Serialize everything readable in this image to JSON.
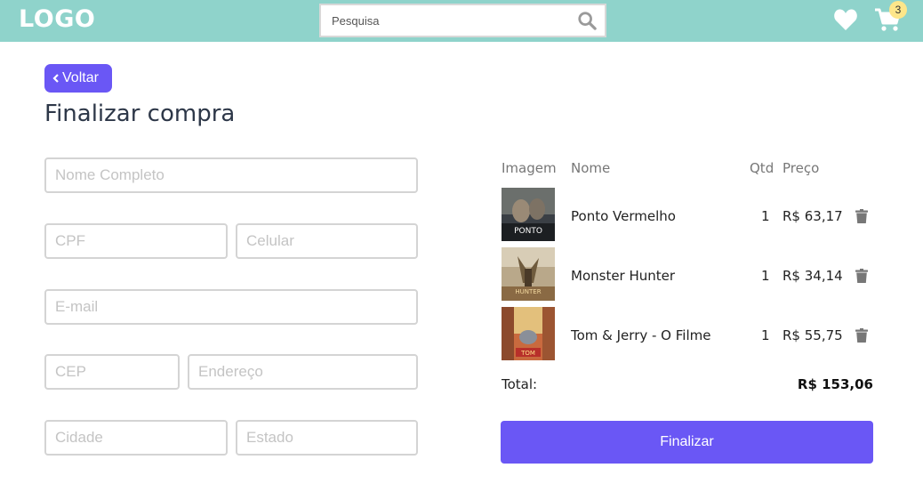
{
  "header": {
    "logo": "LOGO",
    "search_placeholder": "Pesquisa",
    "cart_count": "3",
    "colors": {
      "bar": "#8fd3cb",
      "badge": "#fde68a"
    }
  },
  "page": {
    "back_label": "Voltar",
    "title": "Finalizar compra",
    "accent": "#6a57f5"
  },
  "form": {
    "nome": "Nome Completo",
    "cpf": "CPF",
    "celular": "Celular",
    "email": "E-mail",
    "cep": "CEP",
    "endereco": "Endereço",
    "cidade": "Cidade",
    "estado": "Estado"
  },
  "cart": {
    "headers": {
      "imagem": "Imagem",
      "nome": "Nome",
      "qtd": "Qtd",
      "preco": "Preço"
    },
    "items": [
      {
        "name": "Ponto Vermelho",
        "qty": "1",
        "price": "R$ 63,17",
        "poster_text": "PONTO"
      },
      {
        "name": "Monster Hunter",
        "qty": "1",
        "price": "R$ 34,14",
        "poster_text": "HUNTER"
      },
      {
        "name": "Tom & Jerry - O Filme",
        "qty": "1",
        "price": "R$ 55,75",
        "poster_text": "TOM"
      }
    ],
    "total_label": "Total:",
    "total_value": "R$ 153,06",
    "finish_label": "Finalizar"
  }
}
